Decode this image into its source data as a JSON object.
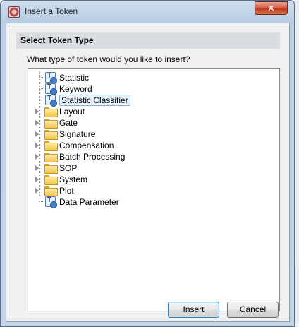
{
  "window": {
    "title": "Insert a Token",
    "close_glyph": "✕",
    "app_icon": "flowjo-icon"
  },
  "dialog": {
    "section_header": "Select Token Type",
    "prompt": "What type of token would you like to insert?"
  },
  "tree": {
    "items": [
      {
        "label": "Statistic",
        "icon": "token-icon",
        "expandable": false,
        "selected": false
      },
      {
        "label": "Keyword",
        "icon": "token-icon",
        "expandable": false,
        "selected": false
      },
      {
        "label": "Statistic Classifier",
        "icon": "token-icon",
        "expandable": false,
        "selected": true
      },
      {
        "label": "Layout",
        "icon": "folder-icon",
        "expandable": true,
        "selected": false
      },
      {
        "label": "Gate",
        "icon": "folder-icon",
        "expandable": true,
        "selected": false
      },
      {
        "label": "Signature",
        "icon": "folder-icon",
        "expandable": true,
        "selected": false
      },
      {
        "label": "Compensation",
        "icon": "folder-icon",
        "expandable": true,
        "selected": false
      },
      {
        "label": "Batch Processing",
        "icon": "folder-icon",
        "expandable": true,
        "selected": false
      },
      {
        "label": "SOP",
        "icon": "folder-icon",
        "expandable": true,
        "selected": false
      },
      {
        "label": "System",
        "icon": "folder-icon",
        "expandable": true,
        "selected": false
      },
      {
        "label": "Plot",
        "icon": "folder-icon",
        "expandable": true,
        "selected": false
      },
      {
        "label": "Data Parameter",
        "icon": "token-icon",
        "expandable": false,
        "selected": false
      }
    ]
  },
  "buttons": {
    "insert": "Insert",
    "cancel": "Cancel"
  }
}
